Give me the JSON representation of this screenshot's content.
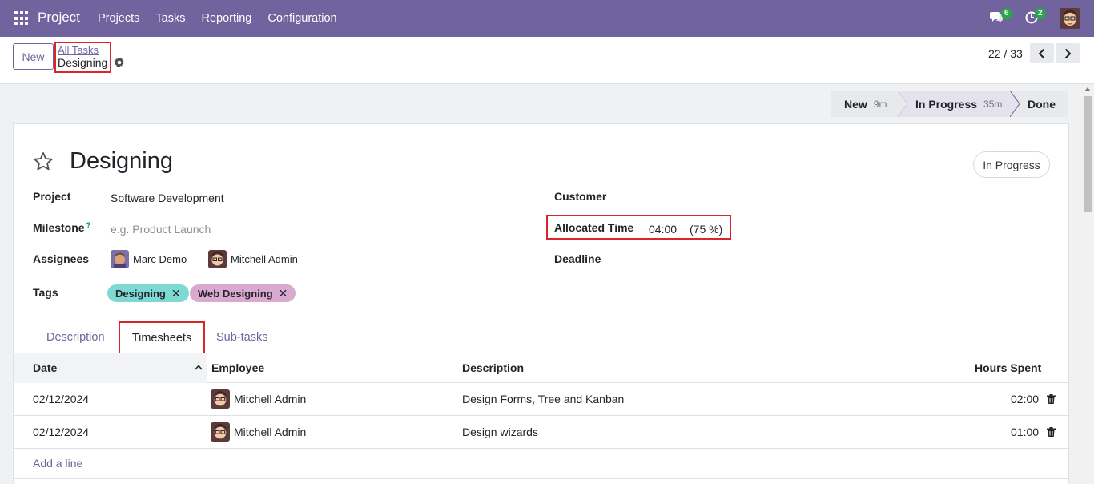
{
  "navbar": {
    "brand": "Project",
    "menu": [
      "Projects",
      "Tasks",
      "Reporting",
      "Configuration"
    ],
    "messages_badge": "6",
    "activities_badge": "2",
    "color": "#71639e"
  },
  "control": {
    "new_label": "New",
    "breadcrumb_parent": "All Tasks",
    "breadcrumb_current": "Designing",
    "pager": "22 / 33"
  },
  "statusbar": {
    "stages": [
      {
        "label": "New",
        "duration": "9m"
      },
      {
        "label": "In Progress",
        "duration": "35m"
      },
      {
        "label": "Done",
        "duration": ""
      }
    ]
  },
  "task": {
    "title": "Designing",
    "state": "In Progress",
    "project_label": "Project",
    "project_value": "Software Development",
    "milestone_label": "Milestone",
    "milestone_help": "?",
    "milestone_placeholder": "e.g. Product Launch",
    "assignees_label": "Assignees",
    "assignees": [
      "Marc Demo",
      "Mitchell Admin"
    ],
    "tags_label": "Tags",
    "tags": [
      {
        "name": "Designing",
        "color": "#7ed9d3"
      },
      {
        "name": "Web Designing",
        "color": "#d9a9cf"
      }
    ],
    "customer_label": "Customer",
    "allocated_label": "Allocated Time",
    "allocated_value": "04:00",
    "allocated_percent": "(75 %)",
    "deadline_label": "Deadline"
  },
  "tabs": [
    "Description",
    "Timesheets",
    "Sub-tasks"
  ],
  "timesheets": {
    "headers": [
      "Date",
      "Employee",
      "Description",
      "Hours Spent"
    ],
    "rows": [
      {
        "date": "02/12/2024",
        "employee": "Mitchell Admin",
        "description": "Design Forms, Tree and Kanban",
        "hours": "02:00"
      },
      {
        "date": "02/12/2024",
        "employee": "Mitchell Admin",
        "description": "Design wizards",
        "hours": "01:00"
      }
    ],
    "add_line": "Add a line"
  }
}
